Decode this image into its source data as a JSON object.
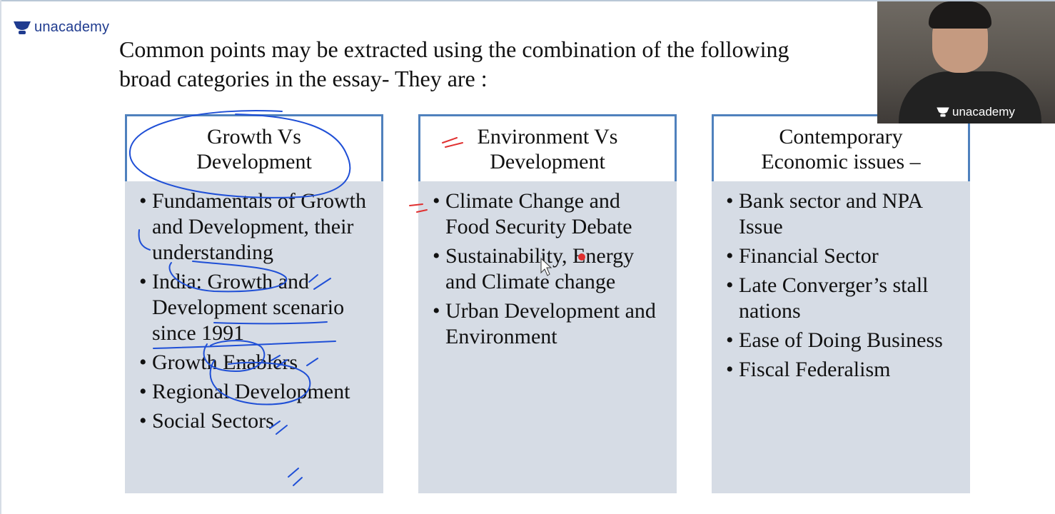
{
  "brand": {
    "name": "unacademy"
  },
  "intro": {
    "line1": "Common points may be extracted using the combination of the following",
    "line2": "broad categories in the essay- They are :"
  },
  "columns": [
    {
      "title_line1": "Growth Vs",
      "title_line2": "Development",
      "items": [
        "Fundamentals of Growth and Development, their understanding",
        "India: Growth and Development scenario since 1991",
        "Growth Enablers",
        "Regional Development",
        "Social Sectors"
      ]
    },
    {
      "title_line1": "Environment Vs",
      "title_line2": "Development",
      "items": [
        "Climate Change and Food Security Debate",
        "Sustainability, Energy and Climate change",
        "Urban Development and Environment"
      ]
    },
    {
      "title_line1": "Contemporary",
      "title_line2": "Economic issues –",
      "items": [
        "Bank sector and NPA Issue",
        "Financial Sector",
        "Late Converger’s  stall nations",
        "Ease of Doing Business",
        "Fiscal Federalism"
      ]
    }
  ],
  "webcam": {
    "overlay_brand": "unacademy"
  },
  "colors": {
    "header_border": "#4f81bd",
    "body_fill": "#d6dce5",
    "brand": "#1f3b8f",
    "annotation_blue": "#1f4fd6",
    "annotation_red": "#e03030"
  }
}
